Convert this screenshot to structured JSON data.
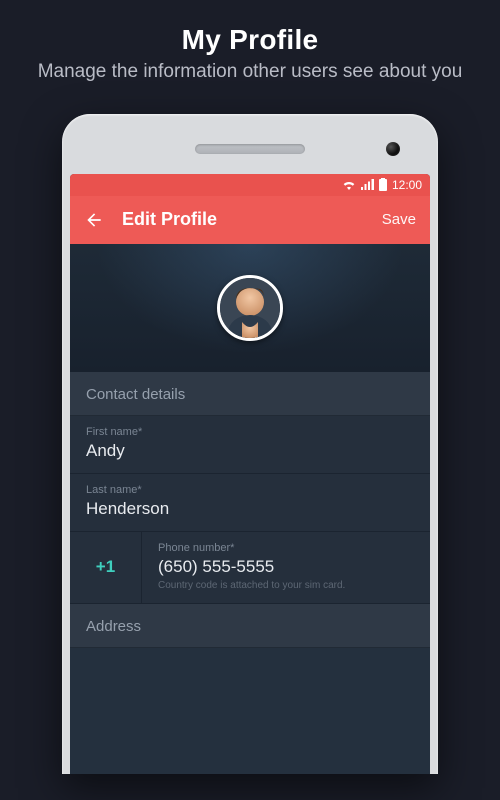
{
  "promo": {
    "title": "My Profile",
    "subtitle": "Manage the information other users see about you"
  },
  "statusbar": {
    "time": "12:00"
  },
  "appbar": {
    "title": "Edit Profile",
    "save": "Save"
  },
  "sections": {
    "contact_details": "Contact details",
    "address": "Address"
  },
  "fields": {
    "first_name": {
      "label": "First name*",
      "value": "Andy"
    },
    "last_name": {
      "label": "Last name*",
      "value": "Henderson"
    },
    "phone": {
      "country_code": "+1",
      "label": "Phone number*",
      "value": "(650) 555-5555",
      "hint": "Country code is attached to your sim card."
    }
  }
}
